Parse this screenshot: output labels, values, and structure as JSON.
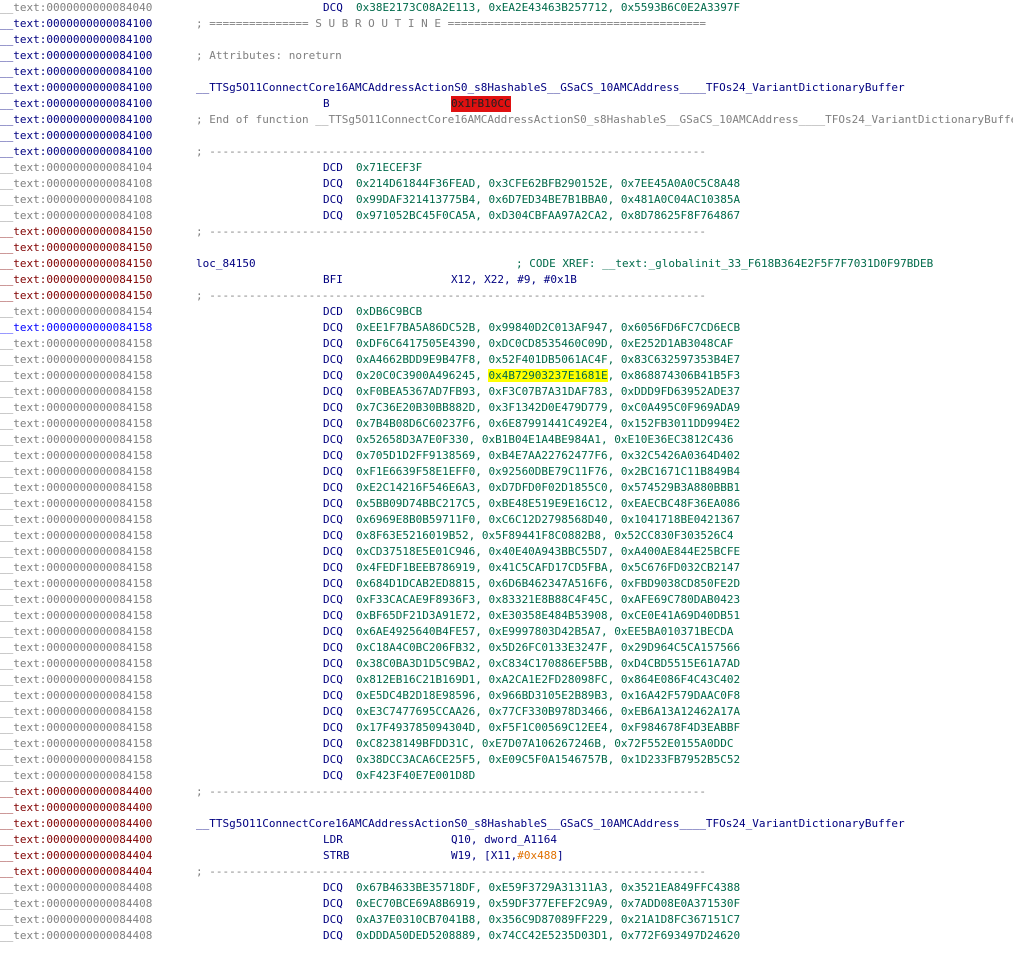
{
  "lines": [
    {
      "addr": "__text:0000000000084040",
      "addr_color": "gray",
      "mnem": "DCQ",
      "ops": "0x38E2173C08A2E113, 0xEA2E43463B257712, 0x5593B6C0E2A3397F"
    },
    {
      "addr": "__text:0000000000084100",
      "addr_color": "black",
      "comment": "; =============== S U B R O U T I N E ======================================="
    },
    {
      "addr": "__text:0000000000084100",
      "addr_color": "black"
    },
    {
      "addr": "__text:0000000000084100",
      "addr_color": "black",
      "comment": "; Attributes: noreturn"
    },
    {
      "addr": "__text:0000000000084100",
      "addr_color": "black"
    },
    {
      "addr": "__text:0000000000084100",
      "addr_color": "black",
      "label": "__TTSg5O11ConnectCore16AMCAddressActionS0_s8HashableS__GSaCS_10AMCAddress____TFOs24_VariantDictionaryBuffer"
    },
    {
      "addr": "__text:0000000000084100",
      "addr_color": "black",
      "mnem": "B",
      "target": "0x1FB10CC"
    },
    {
      "addr": "__text:0000000000084100",
      "addr_color": "black",
      "comment": "; End of function __TTSg5O11ConnectCore16AMCAddressActionS0_s8HashableS__GSaCS_10AMCAddress____TFOs24_VariantDictionaryBuffer"
    },
    {
      "addr": "__text:0000000000084100",
      "addr_color": "black"
    },
    {
      "addr": "__text:0000000000084100",
      "addr_color": "black",
      "comment": "; ---------------------------------------------------------------------------"
    },
    {
      "addr": "__text:0000000000084104",
      "addr_color": "gray",
      "mnem": "DCD",
      "ops": "0x71ECEF3F"
    },
    {
      "addr": "__text:0000000000084108",
      "addr_color": "gray",
      "mnem": "DCQ",
      "ops": "0x214D61844F36FEAD, 0x3CFE62BFB290152E, 0x7EE45A0A0C5C8A48"
    },
    {
      "addr": "__text:0000000000084108",
      "addr_color": "gray",
      "mnem": "DCQ",
      "ops": "0x99DAF321413775B4, 0x6D7ED34BE7B1BBA0, 0x481A0C04AC10385A"
    },
    {
      "addr": "__text:0000000000084108",
      "addr_color": "gray",
      "mnem": "DCQ",
      "ops": "0x971052BC45F0CA5A, 0xD304CBFAA97A2CA2, 0x8D78625F8F764867"
    },
    {
      "addr": "__text:0000000000084150",
      "addr_color": "maroon",
      "comment": "; ---------------------------------------------------------------------------"
    },
    {
      "addr": "__text:0000000000084150",
      "addr_color": "maroon"
    },
    {
      "addr": "__text:0000000000084150",
      "addr_color": "maroon",
      "label": "loc_84150",
      "xref": "; CODE XREF: __text:_globalinit_33_F618B364E2F5F7F7031D0F97BDEB"
    },
    {
      "addr": "__text:0000000000084150",
      "addr_color": "maroon",
      "mnem": "BFI",
      "ops_wide": "X12, X22, #9, #0x1B"
    },
    {
      "addr": "__text:0000000000084150",
      "addr_color": "maroon",
      "comment": "; ---------------------------------------------------------------------------"
    },
    {
      "addr": "__text:0000000000084154",
      "addr_color": "gray",
      "mnem": "DCD",
      "ops": "0xDB6C9BCB"
    },
    {
      "addr": "__text:0000000000084158",
      "addr_color": "blue",
      "mnem": "DCQ",
      "ops": "0xEE1F7BA5A86DC52B, 0x99840D2C013AF947, 0x6056FD6FC7CD6ECB"
    },
    {
      "addr": "__text:0000000000084158",
      "addr_color": "gray",
      "mnem": "DCQ",
      "ops": "0xDF6C6417505E4390, 0xDC0CD8535460C09D, 0xE252D1AB3048CAF"
    },
    {
      "addr": "__text:0000000000084158",
      "addr_color": "gray",
      "mnem": "DCQ",
      "ops": "0xA4662BDD9E9B47F8, 0x52F401DB5061AC4F, 0x83C632597353B4E7"
    },
    {
      "addr": "__text:0000000000084158",
      "addr_color": "gray",
      "mnem": "DCQ",
      "ops_parts": [
        "0x20C0C3900A496245, ",
        "0x4B72903237E1681E",
        ", 0x868874306B41B5F3"
      ]
    },
    {
      "addr": "__text:0000000000084158",
      "addr_color": "gray",
      "mnem": "DCQ",
      "ops": "0xF0BEA5367AD7FB93, 0xF3C07B7A31DAF783, 0xDDD9FD63952ADE37"
    },
    {
      "addr": "__text:0000000000084158",
      "addr_color": "gray",
      "mnem": "DCQ",
      "ops": "0x7C36E20B30BB882D, 0x3F1342D0E479D779, 0xC0A495C0F969ADA9"
    },
    {
      "addr": "__text:0000000000084158",
      "addr_color": "gray",
      "mnem": "DCQ",
      "ops": "0x7B4B08D6C60237F6, 0x6E87991441C492E4, 0x152FB3011DD994E2"
    },
    {
      "addr": "__text:0000000000084158",
      "addr_color": "gray",
      "mnem": "DCQ",
      "ops": "0x52658D3A7E0F330, 0xB1B04E1A4BE984A1, 0xE10E36EC3812C436"
    },
    {
      "addr": "__text:0000000000084158",
      "addr_color": "gray",
      "mnem": "DCQ",
      "ops": "0x705D1D2FF9138569, 0xB4E7AA22762477F6, 0x32C5426A0364D402"
    },
    {
      "addr": "__text:0000000000084158",
      "addr_color": "gray",
      "mnem": "DCQ",
      "ops": "0xF1E6639F58E1EFF0, 0x92560DBE79C11F76, 0x2BC1671C11B849B4"
    },
    {
      "addr": "__text:0000000000084158",
      "addr_color": "gray",
      "mnem": "DCQ",
      "ops": "0xE2C14216F546E6A3, 0xD7DFD0F02D1855C0, 0x574529B3A880BBB1"
    },
    {
      "addr": "__text:0000000000084158",
      "addr_color": "gray",
      "mnem": "DCQ",
      "ops": "0x5BB09D74BBC217C5, 0xBE48E519E9E16C12, 0xEAECBC48F36EA086"
    },
    {
      "addr": "__text:0000000000084158",
      "addr_color": "gray",
      "mnem": "DCQ",
      "ops": "0x6969E8B0B59711F0, 0xC6C12D2798568D40, 0x1041718BE0421367"
    },
    {
      "addr": "__text:0000000000084158",
      "addr_color": "gray",
      "mnem": "DCQ",
      "ops": "0x8F63E5216019B52, 0x5F89441F8C0882B8, 0x52CC830F303526C4"
    },
    {
      "addr": "__text:0000000000084158",
      "addr_color": "gray",
      "mnem": "DCQ",
      "ops": "0xCD37518E5E01C946, 0x40E40A943BBC55D7, 0xA400AE844E25BCFE"
    },
    {
      "addr": "__text:0000000000084158",
      "addr_color": "gray",
      "mnem": "DCQ",
      "ops": "0x4FEDF1BEEB786919, 0x41C5CAFD17CD5FBA, 0x5C676FD032CB2147"
    },
    {
      "addr": "__text:0000000000084158",
      "addr_color": "gray",
      "mnem": "DCQ",
      "ops": "0x684D1DCAB2ED8815, 0x6D6B462347A516F6, 0xFBD9038CD850FE2D"
    },
    {
      "addr": "__text:0000000000084158",
      "addr_color": "gray",
      "mnem": "DCQ",
      "ops": "0xF33CACAE9F8936F3, 0x83321E8B88C4F45C, 0xAFE69C780DAB0423"
    },
    {
      "addr": "__text:0000000000084158",
      "addr_color": "gray",
      "mnem": "DCQ",
      "ops": "0xBF65DF21D3A91E72, 0xE30358E484B53908, 0xCE0E41A69D40DB51"
    },
    {
      "addr": "__text:0000000000084158",
      "addr_color": "gray",
      "mnem": "DCQ",
      "ops": "0x6AE4925640B4FE57, 0xE9997803D42B5A7, 0xEE5BA010371BECDA"
    },
    {
      "addr": "__text:0000000000084158",
      "addr_color": "gray",
      "mnem": "DCQ",
      "ops": "0xC18A4C0BC206FB32, 0x5D26FC0133E3247F, 0x29D964C5CA157566"
    },
    {
      "addr": "__text:0000000000084158",
      "addr_color": "gray",
      "mnem": "DCQ",
      "ops": "0x38C0BA3D1D5C9BA2, 0xC834C170886EF5BB, 0xD4CBD5515E61A7AD"
    },
    {
      "addr": "__text:0000000000084158",
      "addr_color": "gray",
      "mnem": "DCQ",
      "ops": "0x812EB16C21B169D1, 0xA2CA1E2FD28098FC, 0x864E086F4C43C402"
    },
    {
      "addr": "__text:0000000000084158",
      "addr_color": "gray",
      "mnem": "DCQ",
      "ops": "0xE5DC4B2D18E98596, 0x966BD3105E2B89B3, 0x16A42F579DAAC0F8"
    },
    {
      "addr": "__text:0000000000084158",
      "addr_color": "gray",
      "mnem": "DCQ",
      "ops": "0xE3C7477695CCAA26, 0x77CF330B978D3466, 0xEB6A13A12462A17A"
    },
    {
      "addr": "__text:0000000000084158",
      "addr_color": "gray",
      "mnem": "DCQ",
      "ops": "0x17F493785094304D, 0xF5F1C00569C12EE4, 0xF984678F4D3EABBF"
    },
    {
      "addr": "__text:0000000000084158",
      "addr_color": "gray",
      "mnem": "DCQ",
      "ops": "0xC8238149BFDD31C, 0xE7D07A106267246B, 0x72F552E0155A0DDC"
    },
    {
      "addr": "__text:0000000000084158",
      "addr_color": "gray",
      "mnem": "DCQ",
      "ops": "0x38DCC3ACA6CE25F5, 0xE09C5F0A1546757B, 0x1D233FB7952B5C52"
    },
    {
      "addr": "__text:0000000000084158",
      "addr_color": "gray",
      "mnem": "DCQ",
      "ops": "0xF423F40E7E001D8D"
    },
    {
      "addr": "__text:0000000000084400",
      "addr_color": "maroon",
      "comment": "; ---------------------------------------------------------------------------"
    },
    {
      "addr": "__text:0000000000084400",
      "addr_color": "maroon"
    },
    {
      "addr": "__text:0000000000084400",
      "addr_color": "maroon",
      "label": "__TTSg5O11ConnectCore16AMCAddressActionS0_s8HashableS__GSaCS_10AMCAddress____TFOs24_VariantDictionaryBuffer"
    },
    {
      "addr": "__text:0000000000084400",
      "addr_color": "maroon",
      "mnem": "LDR",
      "ops_wide": "Q10, dword_A1164"
    },
    {
      "addr": "__text:0000000000084404",
      "addr_color": "maroon",
      "mnem": "STRB",
      "ops_wide_parts": [
        "W19, [X11,",
        "#0x488",
        "]"
      ]
    },
    {
      "addr": "__text:0000000000084404",
      "addr_color": "maroon",
      "comment": "; ---------------------------------------------------------------------------"
    },
    {
      "addr": "__text:0000000000084408",
      "addr_color": "gray",
      "mnem": "DCQ",
      "ops": "0x67B4633BE35718DF, 0xE59F3729A31311A3, 0x3521EA849FFC4388"
    },
    {
      "addr": "__text:0000000000084408",
      "addr_color": "gray",
      "mnem": "DCQ",
      "ops": "0xEC70BCE69A8B6919, 0x59DF377EFEF2C9A9, 0x7ADD08E0A371530F"
    },
    {
      "addr": "__text:0000000000084408",
      "addr_color": "gray",
      "mnem": "DCQ",
      "ops": "0xA37E0310CB7041B8, 0x356C9D87089FF229, 0x21A1D8FC367151C7"
    },
    {
      "addr": "__text:0000000000084408",
      "addr_color": "gray",
      "mnem": "DCQ",
      "ops": "0xDDDA50DED5208889, 0x74CC42E5235D03D1, 0x772F693497D24620"
    }
  ]
}
